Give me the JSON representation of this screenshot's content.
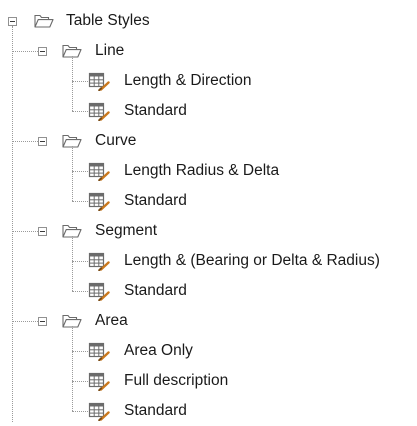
{
  "tree": {
    "root": {
      "label": "Table Styles",
      "groups": [
        {
          "label": "Line",
          "items": [
            "Length & Direction",
            "Standard"
          ]
        },
        {
          "label": "Curve",
          "items": [
            "Length Radius &  Delta",
            "Standard"
          ]
        },
        {
          "label": "Segment",
          "items": [
            "Length & (Bearing or Delta & Radius)",
            "Standard"
          ]
        },
        {
          "label": "Area",
          "items": [
            "Area Only",
            "Full description",
            "Standard"
          ]
        }
      ]
    }
  },
  "icons": {
    "expander": "collapse-minus-icon",
    "folder": "folder-open-icon",
    "style": "table-style-icon"
  },
  "colors": {
    "text": "#1a1a1a",
    "tree_lines": "#9a9a9a",
    "folder_outline": "#6b6b6b",
    "table_icon": "#6b6b6b",
    "brush_accent": "#c9781e"
  }
}
